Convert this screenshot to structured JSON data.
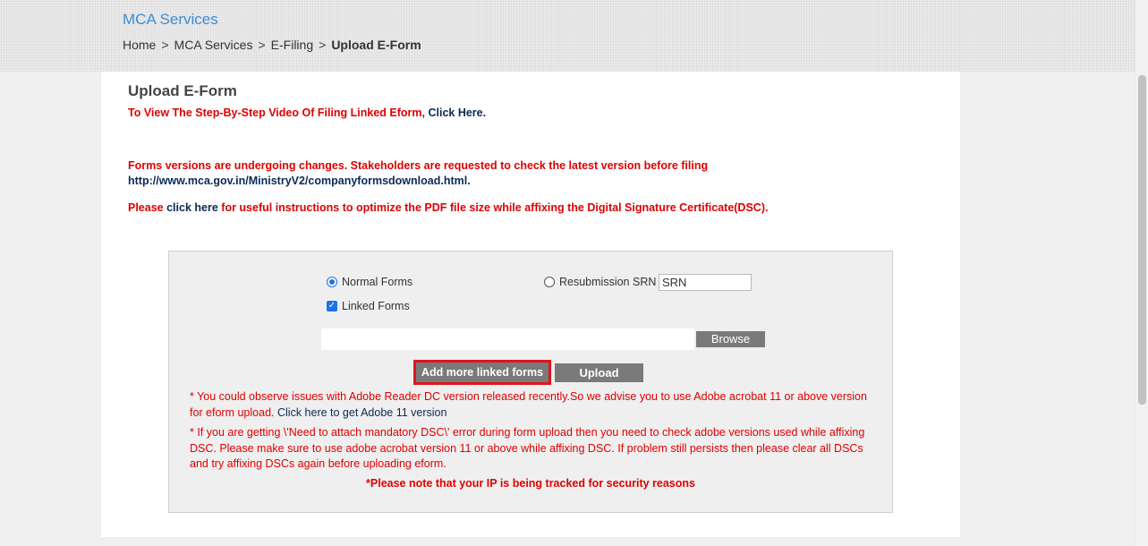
{
  "header": {
    "section_title": "MCA Services",
    "breadcrumb": [
      "Home",
      "MCA Services",
      "E-Filing",
      "Upload E-Form"
    ],
    "separator": ">"
  },
  "page": {
    "title": "Upload E-Form",
    "video_prefix": "To View The Step-By-Step Video Of Filing Linked Eform,",
    "video_link": "Click Here.",
    "versions_notice": "Forms versions are undergoing changes. Stakeholders are requested to check the latest version before filing",
    "versions_url": "http://www.mca.gov.in/MinistryV2/companyformsdownload.html.",
    "pdf_prefix": "Please",
    "pdf_link": "click here",
    "pdf_suffix": "for useful instructions to optimize the PDF file size while affixing the Digital Signature Certificate(DSC)."
  },
  "form": {
    "normal_forms_label": "Normal Forms",
    "normal_forms_checked": true,
    "resubmission_label": "Resubmission SRN",
    "resubmission_checked": false,
    "srn_value": "SRN",
    "linked_forms_label": "Linked Forms",
    "linked_forms_checked": true,
    "file_value": "",
    "browse_label": "Browse",
    "add_linked_label": "Add more linked forms",
    "upload_label": "Upload",
    "note1_text": "* You could observe issues with Adobe Reader DC version released recently.So we advise you to use Adobe acrobat 11 or above version for eform upload.",
    "note1_link": "Click here to get Adobe 11 version",
    "note2_text": "* If you are getting \\'Need to attach mandatory DSC\\' error during form upload then you need to check adobe versions used while affixing DSC. Please make sure to use adobe acrobat version 11 or above while affixing DSC. If problem still persists then please clear all DSCs and try affixing DSCs again before uploading eform.",
    "tracking_note": "*Please note that your IP is being tracked for security reasons"
  },
  "colors": {
    "alert_red": "#e00000",
    "link_navy": "#0b2a55",
    "title_blue": "#3b8ed6",
    "button_gray": "#7a7a7a",
    "highlight_red": "#e0141e"
  }
}
